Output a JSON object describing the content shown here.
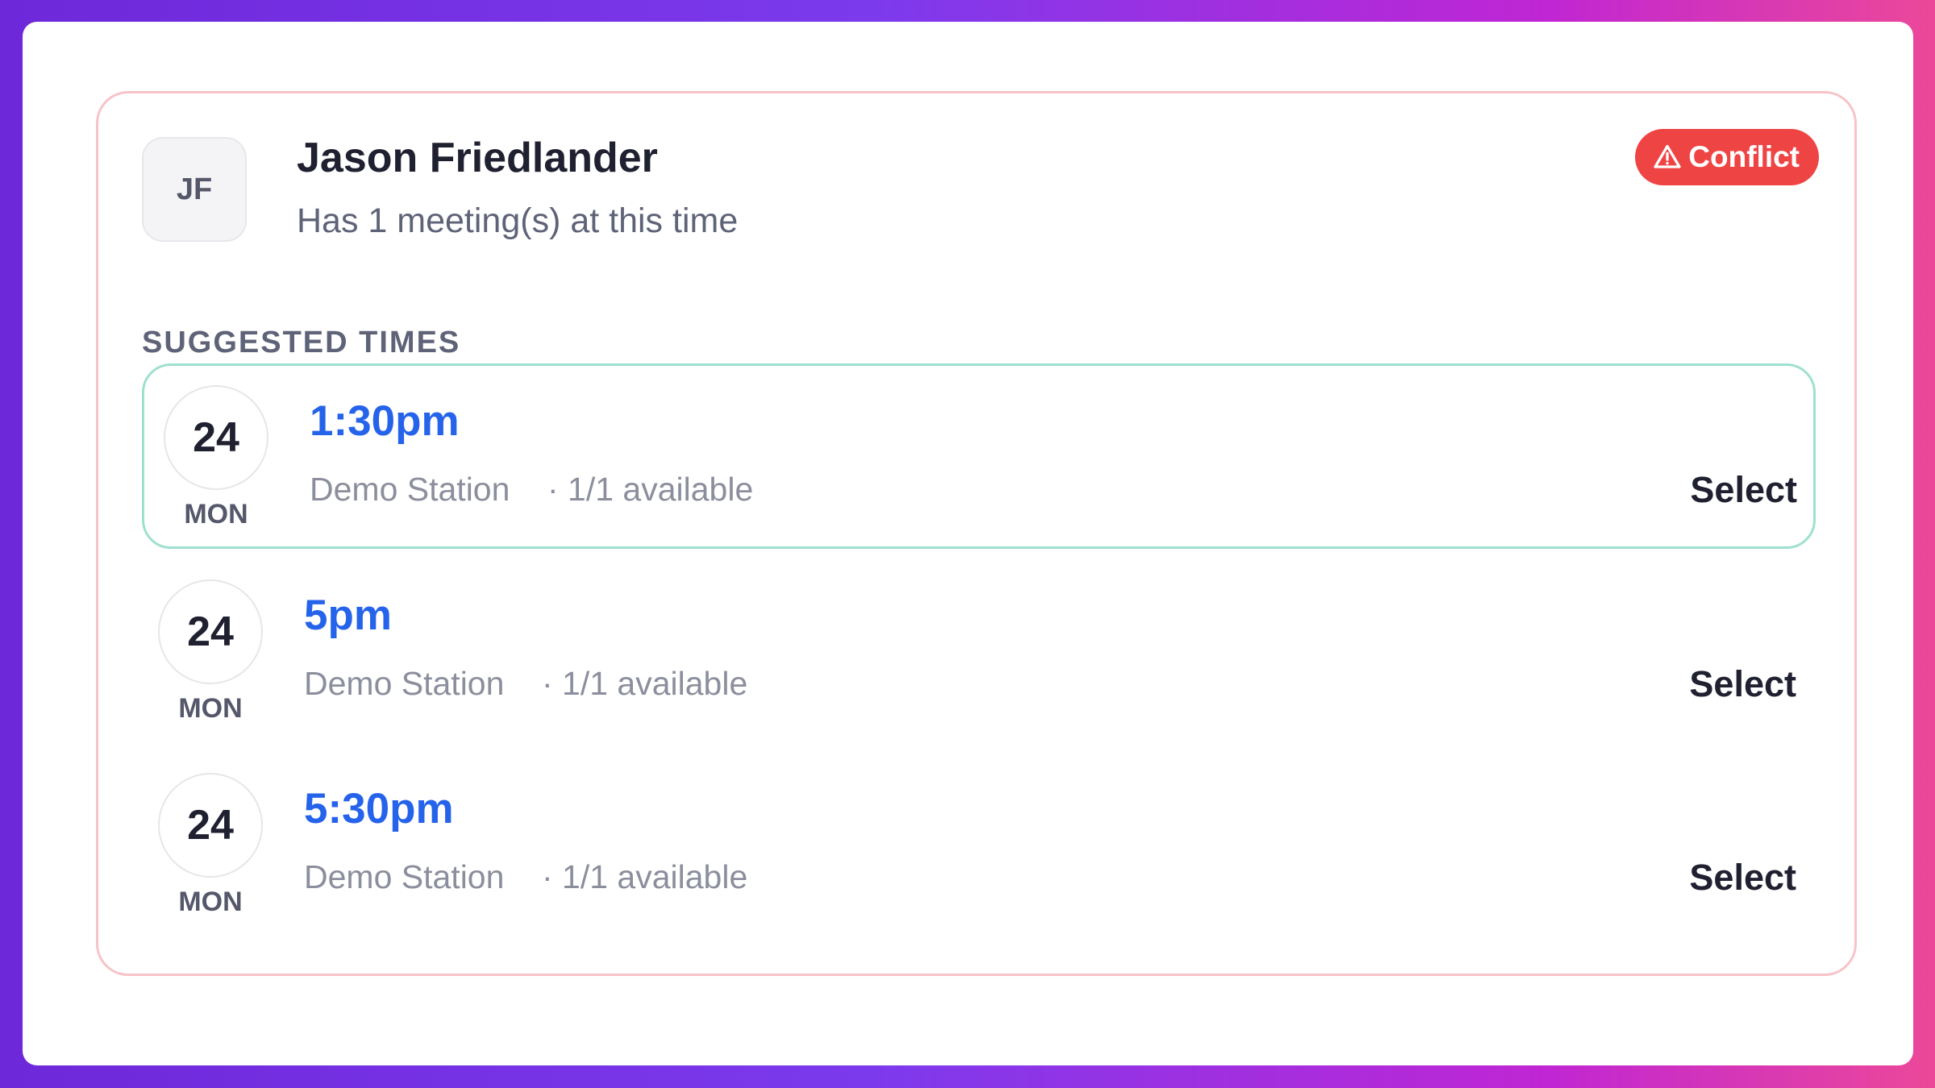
{
  "user": {
    "initials": "JF",
    "name": "Jason Friedlander",
    "subtitle": "Has 1 meeting(s) at this time"
  },
  "badge": {
    "label": "Conflict",
    "icon": "warning-triangle-icon",
    "color": "#ef4444"
  },
  "section": {
    "label": "SUGGESTED TIMES"
  },
  "slots": [
    {
      "date": "24",
      "day": "MON",
      "time": "1:30pm",
      "location": "Demo Station",
      "availability": "· 1/1 available",
      "select_label": "Select",
      "selected": true
    },
    {
      "date": "24",
      "day": "MON",
      "time": "5pm",
      "location": "Demo Station",
      "availability": "· 1/1 available",
      "select_label": "Select",
      "selected": false
    },
    {
      "date": "24",
      "day": "MON",
      "time": "5:30pm",
      "location": "Demo Station",
      "availability": "· 1/1 available",
      "select_label": "Select",
      "selected": false
    }
  ],
  "colors": {
    "time_accent": "#2563eb",
    "selected_border": "#9ee0cf",
    "card_border": "#f7c3c8"
  }
}
